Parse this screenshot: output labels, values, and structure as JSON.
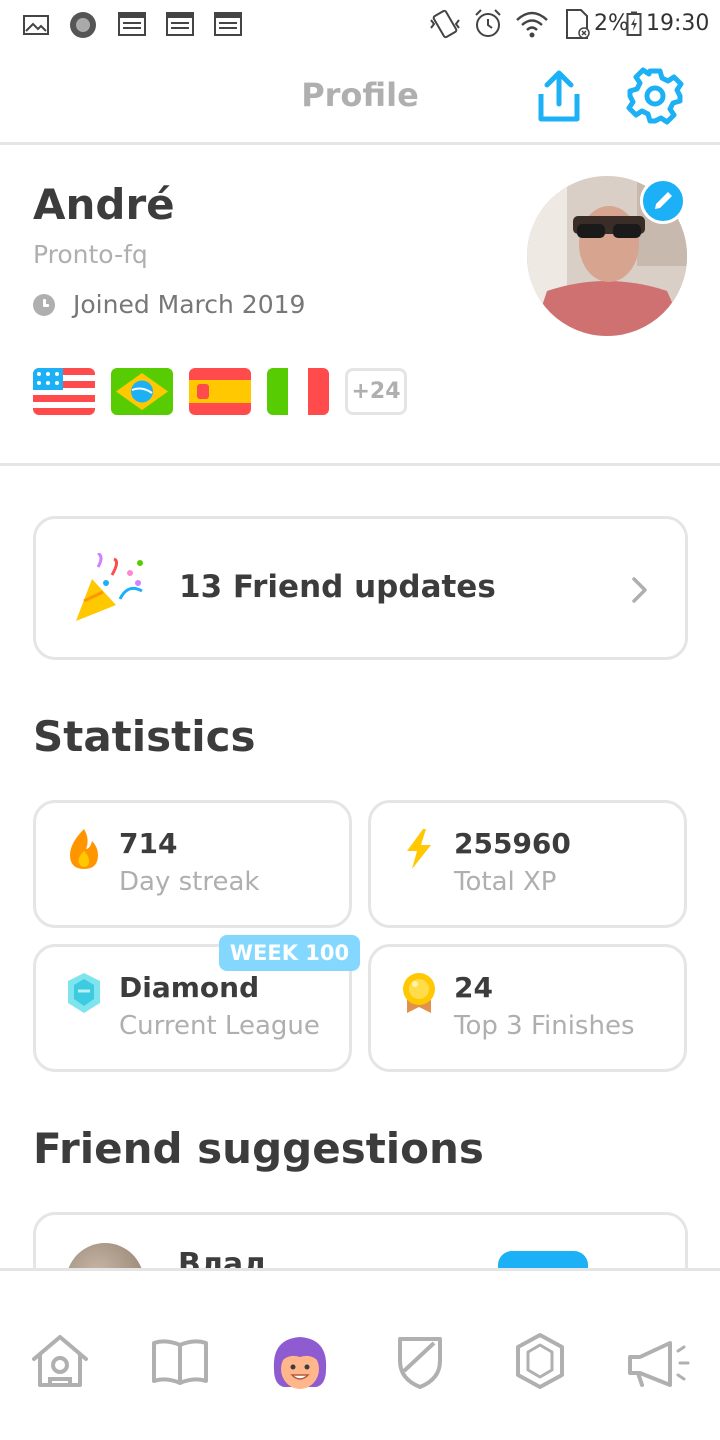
{
  "status_bar": {
    "battery": "2%",
    "time": "19:30"
  },
  "header": {
    "title": "Profile"
  },
  "profile": {
    "name": "André",
    "username": "Pronto-fq",
    "joined": "Joined March 2019",
    "languages": [
      "USA",
      "Brazil",
      "Spain",
      "Italy"
    ],
    "more_languages": "+24"
  },
  "friend_updates": {
    "label": "13 Friend updates"
  },
  "statistics": {
    "title": "Statistics",
    "items": [
      {
        "value": "714",
        "label": "Day streak",
        "icon": "flame-icon"
      },
      {
        "value": "255960",
        "label": "Total XP",
        "icon": "lightning-icon"
      },
      {
        "value": "Diamond",
        "label": "Current League",
        "icon": "diamond-league-icon",
        "badge": "WEEK 100"
      },
      {
        "value": "24",
        "label": "Top 3 Finishes",
        "icon": "medal-icon"
      }
    ]
  },
  "friend_suggestions": {
    "title": "Friend suggestions",
    "items": [
      {
        "name": "Влад"
      }
    ]
  },
  "bottom_nav": [
    "learn",
    "stories",
    "profile",
    "leagues",
    "shop",
    "news"
  ],
  "colors": {
    "accent": "#1cb0f6",
    "border": "#e5e5e5",
    "muted": "#afafaf",
    "text": "#3c3c3c"
  }
}
